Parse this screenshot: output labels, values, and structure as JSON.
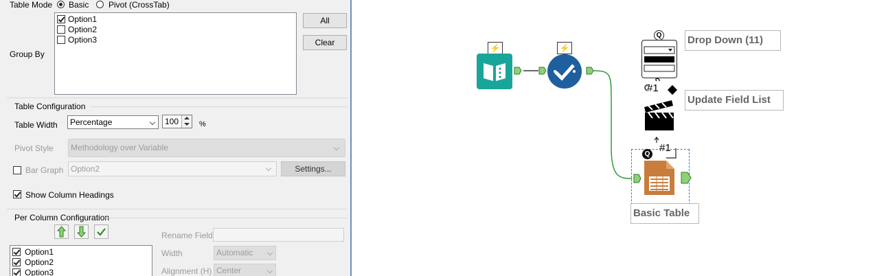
{
  "table_mode": {
    "label": "Table Mode",
    "basic_label": "Basic",
    "pivot_label": "Pivot (CrossTab)",
    "selected": "Basic"
  },
  "group_by": {
    "label": "Group By",
    "options": [
      {
        "label": "Option1",
        "checked": true
      },
      {
        "label": "Option2",
        "checked": false
      },
      {
        "label": "Option3",
        "checked": false
      }
    ],
    "all_label": "All",
    "clear_label": "Clear"
  },
  "table_config": {
    "title": "Table Configuration",
    "width_label": "Table Width",
    "width_mode": "Percentage",
    "width_value": "100",
    "width_unit": "%",
    "pivot_style_label": "Pivot Style",
    "pivot_style_value": "Methodology over Variable",
    "bar_graph_label": "Bar Graph",
    "bar_graph_checked": false,
    "bar_graph_field": "Option2",
    "settings_label": "Settings...",
    "show_headings_label": "Show Column Headings",
    "show_headings_checked": true
  },
  "per_column": {
    "title": "Per Column Configuration",
    "columns": [
      {
        "label": "Option1",
        "checked": true
      },
      {
        "label": "Option2",
        "checked": true
      },
      {
        "label": "Option3",
        "checked": true
      }
    ],
    "rename_field_label": "Rename Field",
    "rename_field_value": "",
    "width_label": "Width",
    "width_value": "Automatic",
    "alignment_label": "Alignment (H)",
    "alignment_value": "Center"
  },
  "canvas": {
    "tools": [
      {
        "name": "Input Tool",
        "icon": "book-input-icon",
        "color": "#1aa59a"
      },
      {
        "name": "Check Tool",
        "icon": "check-circle-icon",
        "color": "#1f5f9e"
      },
      {
        "name": "Drop Down",
        "icon": "dropdown-icon"
      },
      {
        "name": "Update Field List",
        "icon": "clapperboard-icon"
      },
      {
        "name": "Basic Table",
        "icon": "table-icon",
        "color": "#c87d3c"
      }
    ],
    "drop_down_label": "Drop Down (11)",
    "update_field_label": "Update Field List",
    "basic_table_label": "Basic Table",
    "action_tag_1": "#1",
    "action_tag_2": "#1",
    "q_badge": "Q",
    "bolt": "⚡"
  }
}
